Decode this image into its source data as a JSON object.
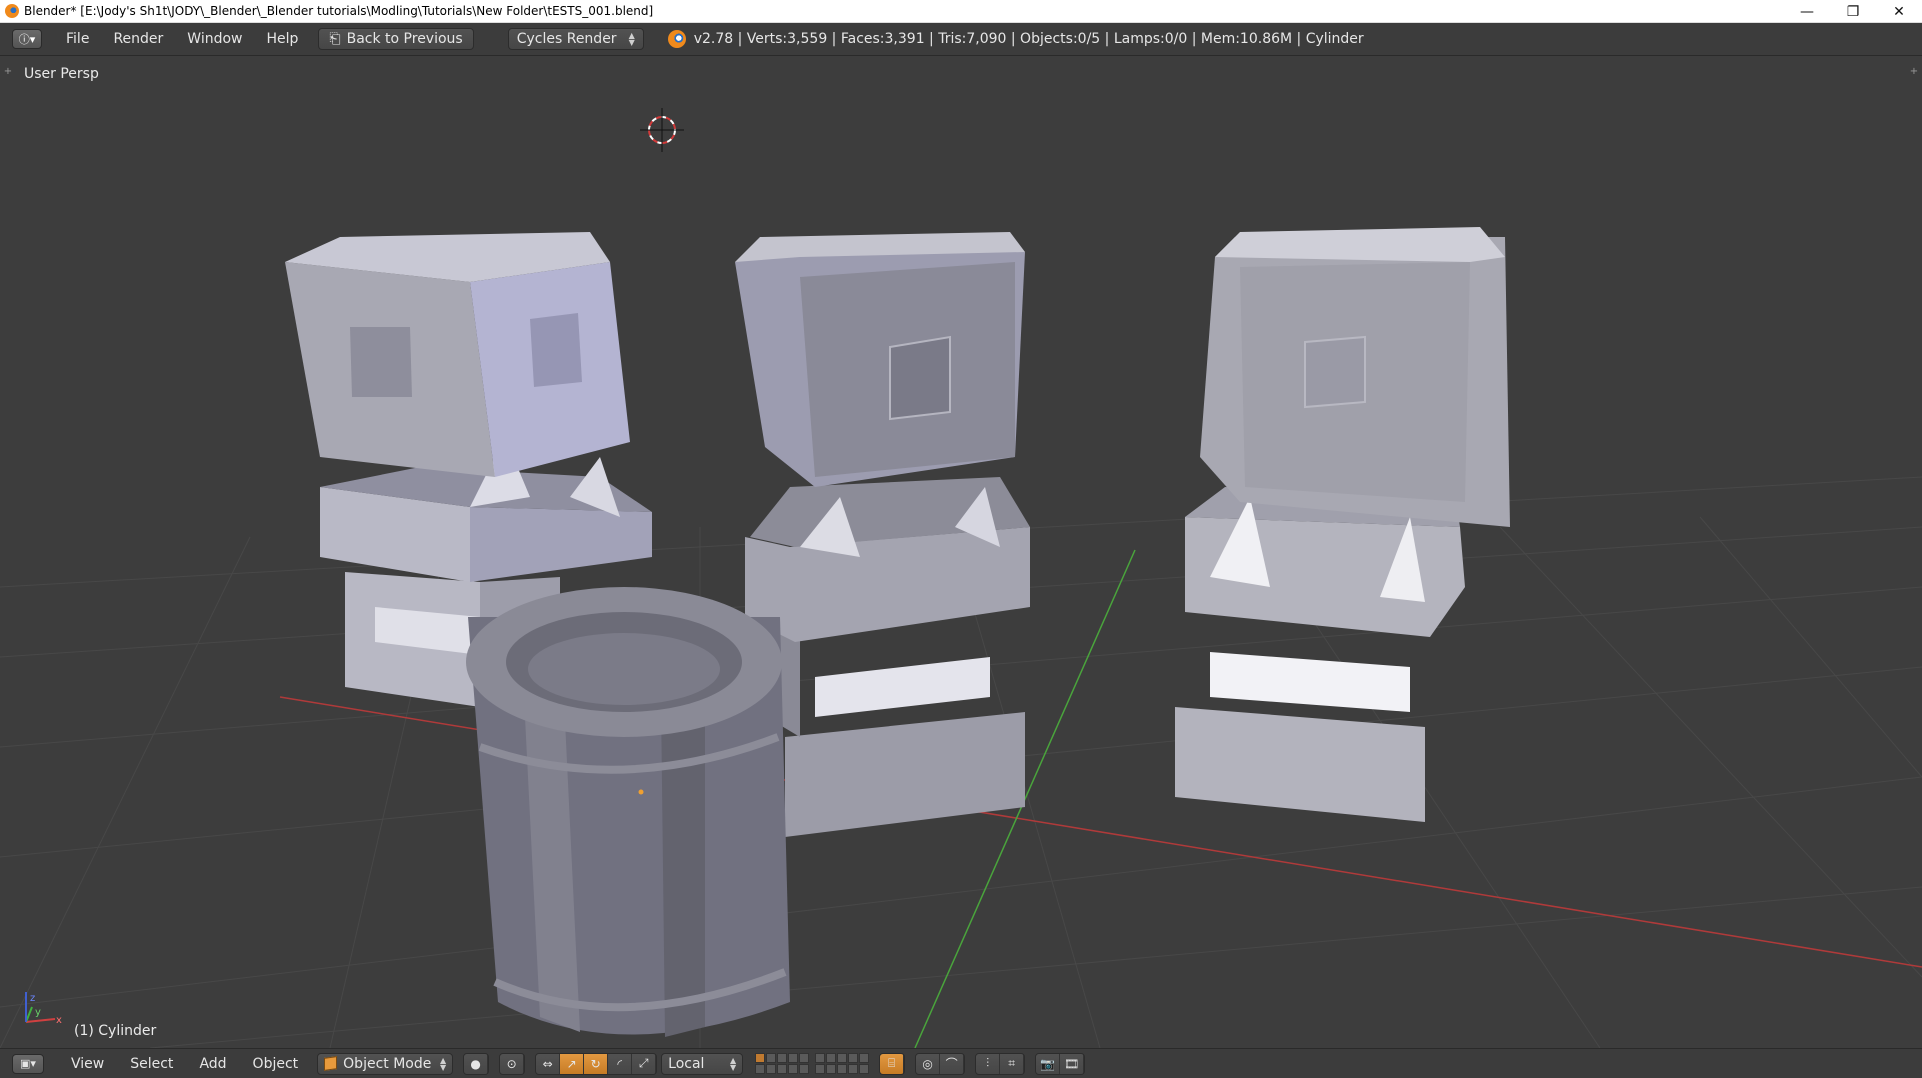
{
  "window": {
    "title": "Blender* [E:\\Jody's Sh1t\\JODY\\_Blender\\_Blender tutorials\\Modling\\Tutorials\\New Folder\\tESTS_001.blend]",
    "controls": [
      "—",
      "❐",
      "✕"
    ]
  },
  "infobar": {
    "menus": [
      "File",
      "Render",
      "Window",
      "Help"
    ],
    "back_label": "Back to Previous",
    "render_engine": "Cycles Render",
    "stats": "v2.78 | Verts:3,559 | Faces:3,391 | Tris:7,090 | Objects:0/5 | Lamps:0/0 | Mem:10.86M | Cylinder"
  },
  "viewport": {
    "view_label": "User Persp",
    "active_object_label": "(1) Cylinder",
    "axis_labels": {
      "x": "x",
      "y": "y",
      "z": "z"
    }
  },
  "bottombar": {
    "menus": [
      "View",
      "Select",
      "Add",
      "Object"
    ],
    "mode": "Object Mode",
    "orientation": "Local"
  },
  "colors": {
    "viewport_bg": "#3d3d3d",
    "header_bg": "#3c3c3c",
    "x_axis": "#b03a3a",
    "y_axis": "#4aa43c",
    "selection_accent": "#e49a42"
  }
}
